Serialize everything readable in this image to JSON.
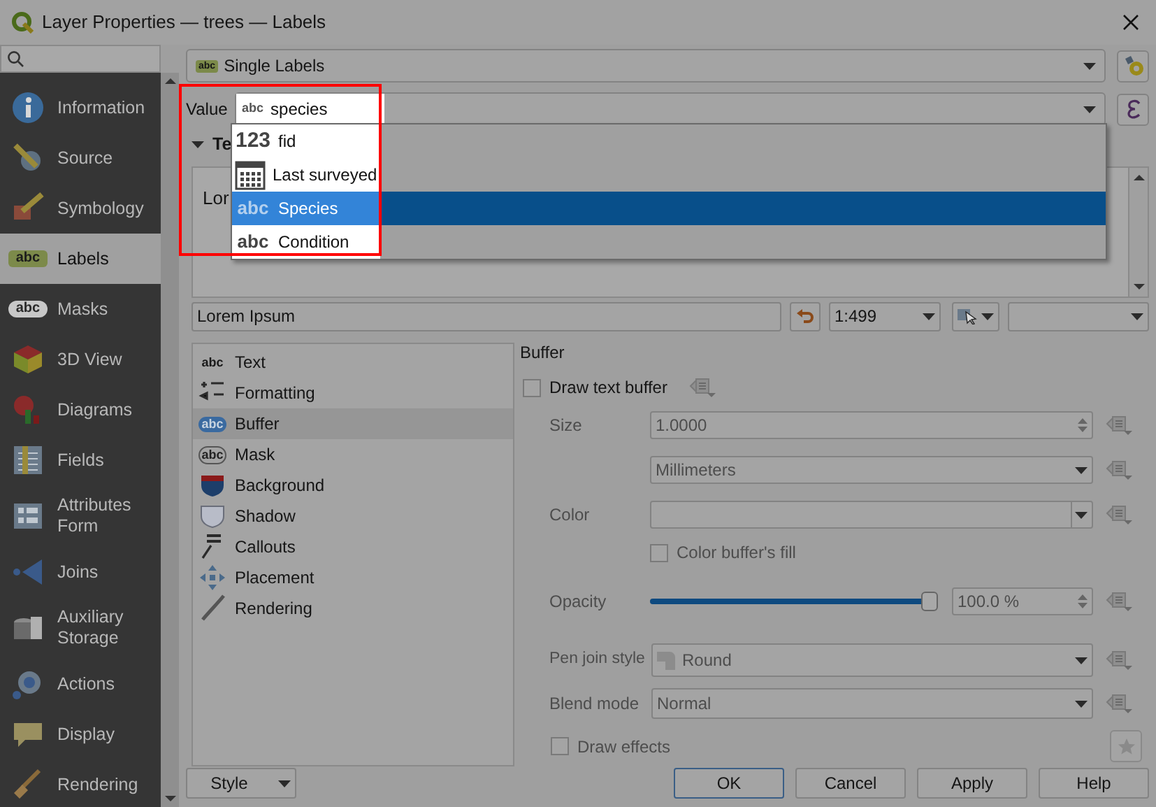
{
  "window": {
    "title": "Layer Properties — trees — Labels"
  },
  "sidebar": {
    "items": [
      {
        "kind": "information",
        "label": "Information",
        "selected": false
      },
      {
        "kind": "source",
        "label": "Source",
        "selected": false
      },
      {
        "kind": "symbology",
        "label": "Symbology",
        "selected": false
      },
      {
        "kind": "labels",
        "icon_text": "abc",
        "label": "Labels",
        "selected": true
      },
      {
        "kind": "masks",
        "icon_text": "abc",
        "label": "Masks",
        "selected": false
      },
      {
        "kind": "view3d",
        "label": "3D View",
        "selected": false
      },
      {
        "kind": "diagrams",
        "label": "Diagrams",
        "selected": false
      },
      {
        "kind": "fields",
        "label": "Fields",
        "selected": false
      },
      {
        "kind": "form",
        "label": "Attributes Form",
        "selected": false
      },
      {
        "kind": "joins",
        "label": "Joins",
        "selected": false
      },
      {
        "kind": "storage",
        "label": "Auxiliary Storage",
        "selected": false
      },
      {
        "kind": "actions",
        "label": "Actions",
        "selected": false
      },
      {
        "kind": "display",
        "label": "Display",
        "selected": false
      },
      {
        "kind": "rendering",
        "label": "Rendering",
        "selected": false
      }
    ]
  },
  "renderer": {
    "icon_text": "abc",
    "value": "Single Labels"
  },
  "value_field": {
    "label": "Value",
    "badge": "abc",
    "value": "species"
  },
  "field_list": {
    "items": [
      {
        "kind": "number",
        "badge": "123",
        "label": "fid",
        "selected": false
      },
      {
        "kind": "date",
        "label": "Last surveyed",
        "selected": false
      },
      {
        "kind": "text",
        "badge": "abc",
        "label": "Species",
        "selected": true
      },
      {
        "kind": "text",
        "badge": "abc",
        "label": "Condition",
        "selected": false
      }
    ]
  },
  "text_section": {
    "title": "Te",
    "preview": "Lor"
  },
  "preview_bar": {
    "sample_text": "Lorem Ipsum",
    "scale": "1:499"
  },
  "tabs": [
    {
      "kind": "text",
      "icon_text": "abc",
      "label": "Text",
      "selected": false
    },
    {
      "kind": "formatting",
      "label": "Formatting",
      "selected": false
    },
    {
      "kind": "buffer",
      "icon_text": "abc",
      "label": "Buffer",
      "selected": true
    },
    {
      "kind": "mask",
      "icon_text": "abc",
      "label": "Mask",
      "selected": false
    },
    {
      "kind": "background",
      "label": "Background",
      "selected": false
    },
    {
      "kind": "shadow",
      "label": "Shadow",
      "selected": false
    },
    {
      "kind": "callouts",
      "label": "Callouts",
      "selected": false
    },
    {
      "kind": "placement",
      "label": "Placement",
      "selected": false
    },
    {
      "kind": "rendering",
      "label": "Rendering",
      "selected": false
    }
  ],
  "buffer": {
    "title": "Buffer",
    "draw_buffer": {
      "label": "Draw text buffer",
      "checked": false
    },
    "size_label": "Size",
    "size": "1.0000",
    "unit": "Millimeters",
    "color_label": "Color",
    "color_fill": {
      "label": "Color buffer's fill",
      "checked": false
    },
    "opacity_label": "Opacity",
    "opacity": {
      "level": 1
    },
    "opacity_value": "100.0 %",
    "pen_join_label": "Pen join style",
    "pen_join": "Round",
    "blend_label": "Blend mode",
    "blend": "Normal",
    "draw_effects": {
      "label": "Draw effects",
      "checked": false
    }
  },
  "style_button": "Style",
  "buttons": [
    "OK",
    "Cancel",
    "Apply",
    "Help"
  ]
}
